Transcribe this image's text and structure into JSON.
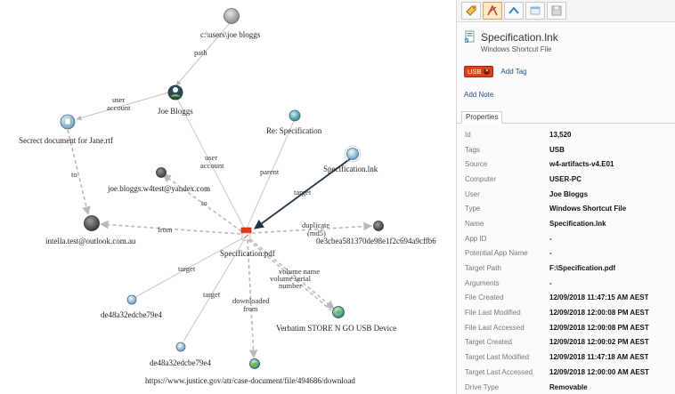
{
  "graph": {
    "nodes": [
      {
        "id": "users_path",
        "label": "c:\\users\\joe bloggs"
      },
      {
        "id": "joe",
        "label": "Joe Bloggs"
      },
      {
        "id": "secret_doc",
        "label": "Secrect document for Jane.rtf"
      },
      {
        "id": "re_spec",
        "label": "Re: Specification"
      },
      {
        "id": "spec_lnk",
        "label": "Specification.lnk"
      },
      {
        "id": "yandex",
        "label": "joe.bloggs.w4test@yandex.com"
      },
      {
        "id": "outlook",
        "label": "intella.test@outlook.com.au"
      },
      {
        "id": "md5",
        "label": "0e3cbea581370de98e1f2c694a9cffb6"
      },
      {
        "id": "spec_pdf",
        "label": "Specification.pdf"
      },
      {
        "id": "hash1",
        "label": "de48a32edcbe79e4"
      },
      {
        "id": "verbatim",
        "label": "Verbatim STORE N GO USB Device"
      },
      {
        "id": "hash2",
        "label": "de48a32edcbe79e4"
      },
      {
        "id": "download",
        "label": "https://www.justice.gov/atr/case-document/file/494686/download"
      }
    ],
    "edges": [
      {
        "id": "e_path",
        "label": "path"
      },
      {
        "id": "e_useracct1",
        "label": "user account"
      },
      {
        "id": "e_to1",
        "label": "to"
      },
      {
        "id": "e_useracct2",
        "label": "user account"
      },
      {
        "id": "e_parent",
        "label": "parent"
      },
      {
        "id": "e_target_lnk",
        "label": "target"
      },
      {
        "id": "e_to2",
        "label": "to"
      },
      {
        "id": "e_from1",
        "label": "from"
      },
      {
        "id": "e_dup",
        "label": "duplicate (md5)"
      },
      {
        "id": "e_target1",
        "label": "target"
      },
      {
        "id": "e_volname",
        "label": "volume name"
      },
      {
        "id": "e_volserial",
        "label": "volume serial number"
      },
      {
        "id": "e_target2",
        "label": "target"
      },
      {
        "id": "e_downfrom",
        "label": "downloaded from"
      }
    ]
  },
  "panel": {
    "toolbar": [
      {
        "name": "tag-tool-icon",
        "active": false
      },
      {
        "name": "flag-tool-icon",
        "active": true
      },
      {
        "name": "up-icon",
        "active": false
      },
      {
        "name": "window-icon",
        "active": false
      },
      {
        "name": "save-icon",
        "active": false
      }
    ],
    "title": "Specification.lnk",
    "subtitle": "Windows Shortcut File",
    "tag_label": "USB",
    "add_tag": "Add Tag",
    "add_note": "Add Note",
    "tab_label": "Properties",
    "properties": [
      {
        "key": "Id",
        "value": "13,520"
      },
      {
        "key": "Tags",
        "value": "USB"
      },
      {
        "key": "Source",
        "value": "w4-artifacts-v4.E01"
      },
      {
        "key": "Computer",
        "value": "USER-PC"
      },
      {
        "key": "User",
        "value": "Joe Bloggs"
      },
      {
        "key": "Type",
        "value": "Windows Shortcut File"
      },
      {
        "key": "Name",
        "value": "Specification.lnk"
      },
      {
        "key": "App ID",
        "value": "-"
      },
      {
        "key": "Potential App Name",
        "value": "-"
      },
      {
        "key": "Target Path",
        "value": "F:\\Specification.pdf"
      },
      {
        "key": "Arguments",
        "value": "-"
      },
      {
        "key": "File Created",
        "value": "12/09/2018 11:47:15 AM AEST"
      },
      {
        "key": "File Last Modified",
        "value": "12/09/2018 12:00:08 PM AEST"
      },
      {
        "key": "File Last Accessed",
        "value": "12/09/2018 12:00:08 PM AEST"
      },
      {
        "key": "Target Created",
        "value": "12/09/2018 12:00:02 PM AEST"
      },
      {
        "key": "Target Last Modified",
        "value": "12/09/2018 11:47:18 AM AEST"
      },
      {
        "key": "Target Last Accessed",
        "value": "12/09/2018 12:00:00 AM AEST"
      },
      {
        "key": "Drive Type",
        "value": "Removable"
      }
    ],
    "colors": {
      "accent": "#1f4f8f",
      "tag": "#e0401c"
    }
  }
}
